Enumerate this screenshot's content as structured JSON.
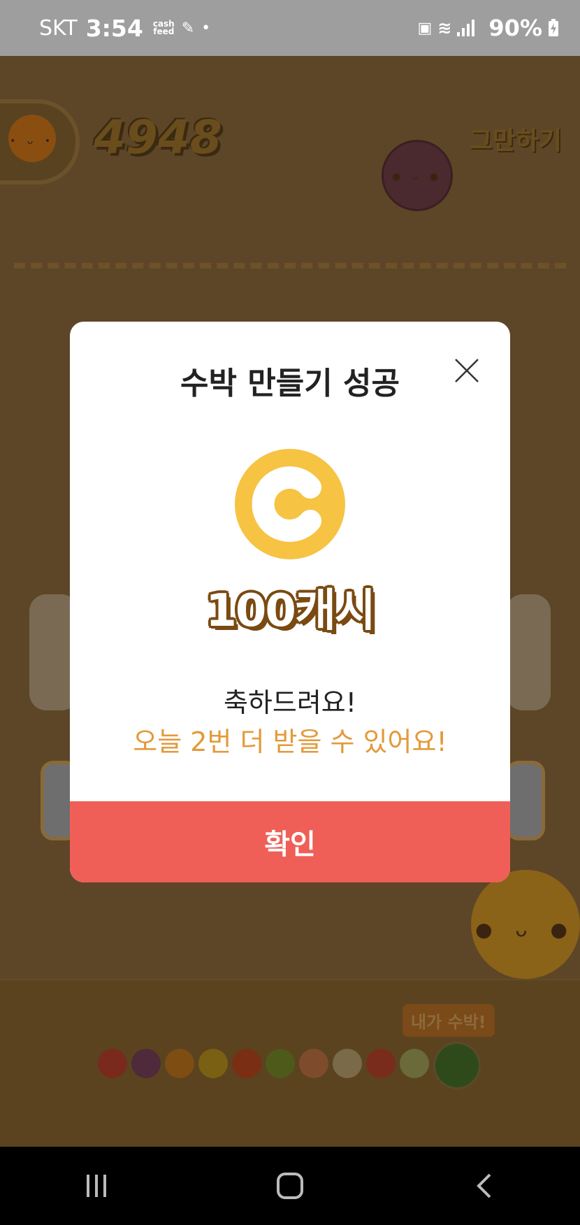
{
  "status_bar": {
    "carrier": "SKT",
    "time": "3:54",
    "app_tag_top": "cash",
    "app_tag_bottom": "feed",
    "dot": "•",
    "battery": "90%"
  },
  "game": {
    "score": "4948",
    "quit_label": "그만하기",
    "next_tag": "내가 수박!"
  },
  "dialog": {
    "title": "수박 만들기 성공",
    "reward": "100캐시",
    "congrats": "축하드려요!",
    "remaining": "오늘 2번 더 받을 수 있어요!",
    "confirm_label": "확인"
  },
  "colors": {
    "coin": "#f6c342",
    "confirm": "#ef5f57",
    "remaining_text": "#e39a3a"
  }
}
